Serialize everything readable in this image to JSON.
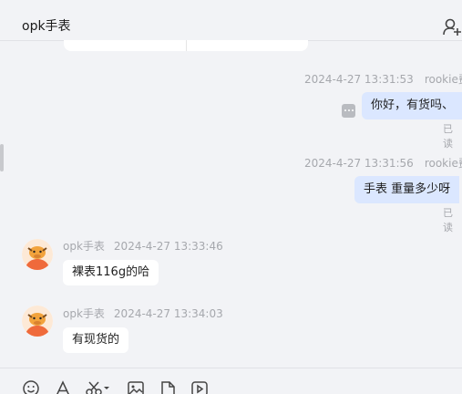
{
  "header": {
    "title": "opk手表",
    "add_member_icon": "add-user-icon"
  },
  "messages": [
    {
      "side": "right",
      "time": "2024-4-27 13:31:53",
      "sender": "rookie费",
      "text": "你好，有货吗、",
      "status": "已读"
    },
    {
      "side": "right",
      "time": "2024-4-27 13:31:56",
      "sender": "rookie费",
      "text": "手表  重量多少呀",
      "status": "已读"
    },
    {
      "side": "left",
      "sender": "opk手表",
      "time": "2024-4-27 13:33:46",
      "text": "裸表116g的哈"
    },
    {
      "side": "left",
      "sender": "opk手表",
      "time": "2024-4-27 13:34:03",
      "text": "有现货的"
    }
  ],
  "toolbar": {
    "icons": [
      "emoji-icon",
      "font-icon",
      "scissors-icon",
      "image-icon",
      "file-icon",
      "video-icon"
    ]
  },
  "colors": {
    "background": "#f2f3f6",
    "self_bubble": "#dbe7ff",
    "other_bubble": "#ffffff",
    "meta_text": "#a6a8ad"
  }
}
